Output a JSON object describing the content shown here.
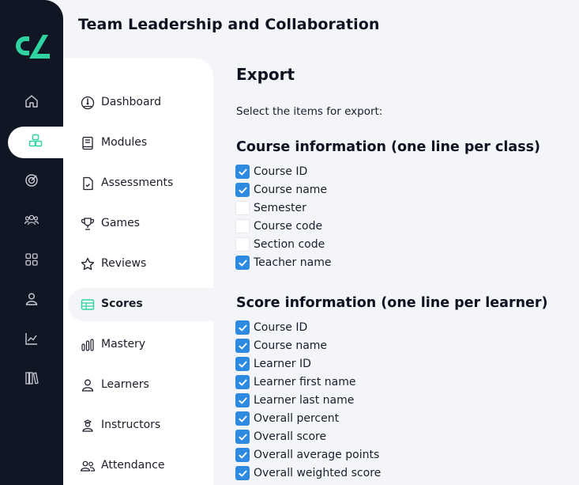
{
  "header": {
    "title": "Team Leadership and Collaboration"
  },
  "rail": {
    "items": [
      {
        "icon": "home-icon",
        "active": false
      },
      {
        "icon": "modules-cubes-icon",
        "active": true
      },
      {
        "icon": "target-icon",
        "active": false
      },
      {
        "icon": "people-icon",
        "active": false
      },
      {
        "icon": "grid-icon",
        "active": false
      },
      {
        "icon": "user-icon",
        "active": false
      },
      {
        "icon": "chart-line-icon",
        "active": false
      },
      {
        "icon": "library-icon",
        "active": false
      }
    ]
  },
  "nav": {
    "items": [
      {
        "label": "Dashboard",
        "icon": "dashboard-gauge-icon"
      },
      {
        "label": "Modules",
        "icon": "book-icon"
      },
      {
        "label": "Assessments",
        "icon": "document-icon"
      },
      {
        "label": "Games",
        "icon": "trophy-icon"
      },
      {
        "label": "Reviews",
        "icon": "star-icon"
      },
      {
        "label": "Scores",
        "icon": "table-icon",
        "active": true
      },
      {
        "label": "Mastery",
        "icon": "bar-chart-icon"
      },
      {
        "label": "Learners",
        "icon": "user-icon"
      },
      {
        "label": "Instructors",
        "icon": "instructor-icon"
      },
      {
        "label": "Attendance",
        "icon": "group-icon"
      }
    ]
  },
  "main": {
    "title": "Export",
    "subtitle": "Select the items for export:",
    "course_section": {
      "title": "Course information (one line per class)",
      "items": [
        {
          "label": "Course ID",
          "checked": true
        },
        {
          "label": "Course name",
          "checked": true
        },
        {
          "label": "Semester",
          "checked": false
        },
        {
          "label": "Course code",
          "checked": false
        },
        {
          "label": "Section code",
          "checked": false
        },
        {
          "label": "Teacher name",
          "checked": true
        }
      ]
    },
    "score_section": {
      "title": "Score information (one line per learner)",
      "items": [
        {
          "label": "Course ID",
          "checked": true
        },
        {
          "label": "Course name",
          "checked": true
        },
        {
          "label": "Learner ID",
          "checked": true
        },
        {
          "label": "Learner first name",
          "checked": true
        },
        {
          "label": "Learner last name",
          "checked": true
        },
        {
          "label": "Overall percent",
          "checked": true
        },
        {
          "label": "Overall score",
          "checked": true
        },
        {
          "label": "Overall average points",
          "checked": true
        },
        {
          "label": "Overall weighted score",
          "checked": true
        }
      ]
    }
  },
  "colors": {
    "rail_bg": "#101623",
    "brand_accent": "#2ed3a0",
    "checkbox_checked": "#2d8ae0",
    "page_bg": "#f3f5f8"
  }
}
